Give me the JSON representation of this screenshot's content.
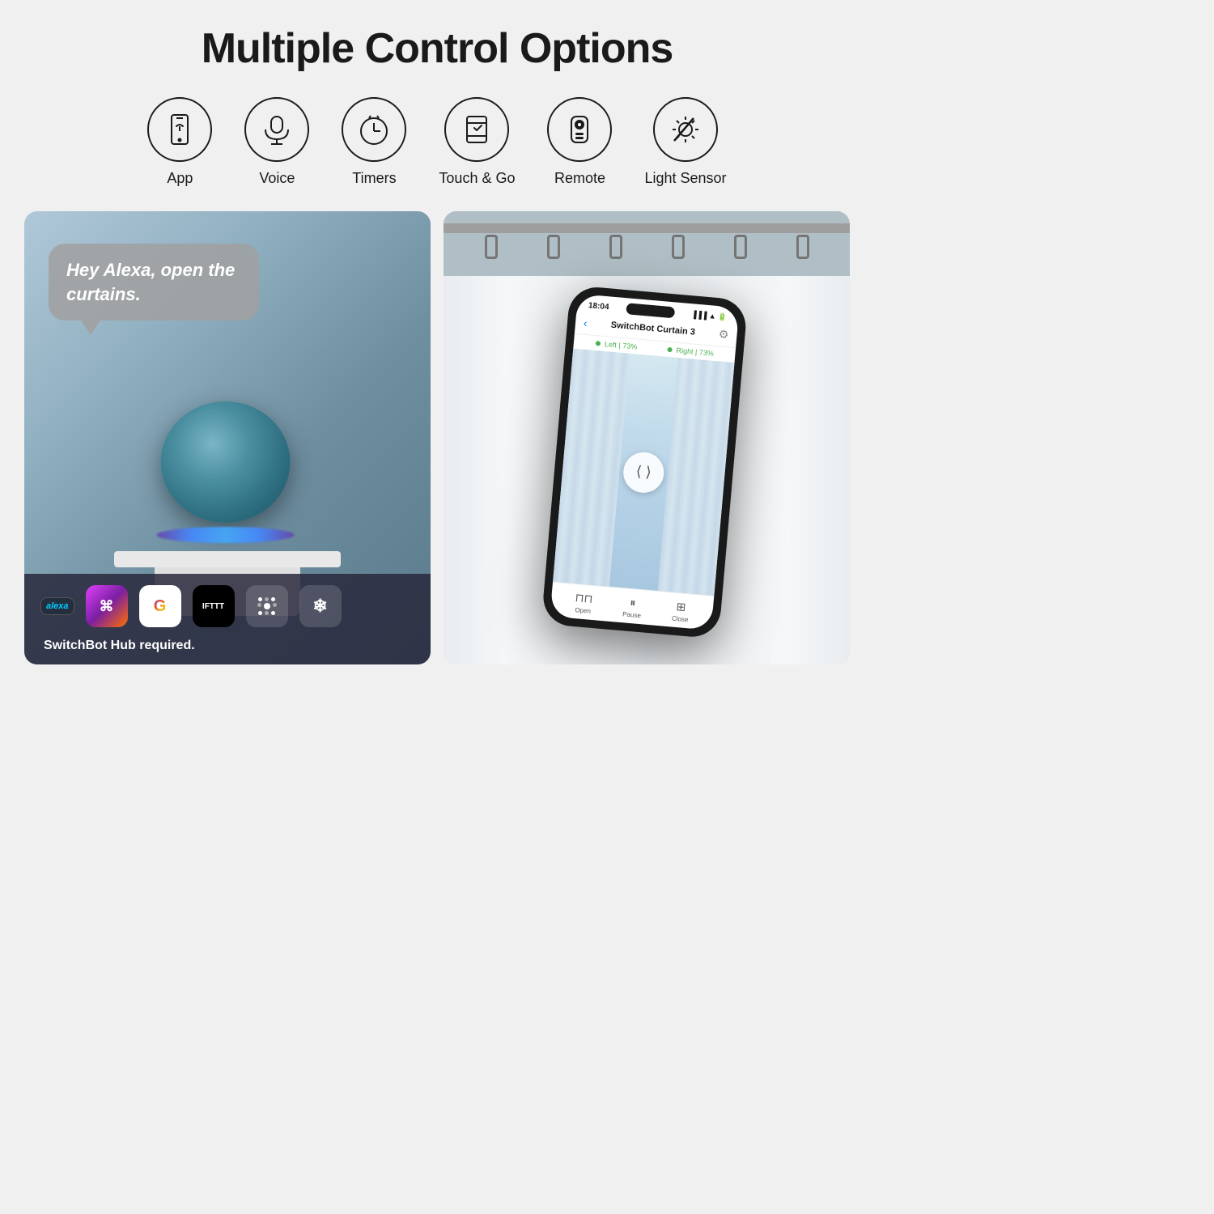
{
  "page": {
    "title": "Multiple Control Options",
    "background_color": "#f0f0f0"
  },
  "control_options": {
    "items": [
      {
        "id": "app",
        "label": "App",
        "icon": "smartphone-icon"
      },
      {
        "id": "voice",
        "label": "Voice",
        "icon": "microphone-icon"
      },
      {
        "id": "timers",
        "label": "Timers",
        "icon": "clock-icon"
      },
      {
        "id": "touch-go",
        "label": "Touch & Go",
        "icon": "touch-icon"
      },
      {
        "id": "remote",
        "label": "Remote",
        "icon": "remote-icon"
      },
      {
        "id": "light-sensor",
        "label": "Light Sensor",
        "icon": "light-sensor-icon"
      }
    ]
  },
  "left_panel": {
    "speech_bubble_text": "Hey Alexa, open the curtains.",
    "hub_required_text": "SwitchBot Hub required.",
    "logos": [
      {
        "id": "alexa",
        "label": "alexa"
      },
      {
        "id": "shortcuts",
        "label": "shortcuts"
      },
      {
        "id": "google",
        "label": "G"
      },
      {
        "id": "ifttt",
        "label": "IFTTT"
      },
      {
        "id": "hub",
        "label": "hub"
      },
      {
        "id": "matter",
        "label": "❄"
      }
    ]
  },
  "right_panel": {
    "phone": {
      "time": "18:04",
      "app_title": "SwitchBot Curtain 3",
      "left_progress": "Left | 73%",
      "right_progress": "Right | 73%",
      "controls": [
        {
          "id": "open",
          "label": "Open"
        },
        {
          "id": "pause",
          "label": "Pause"
        },
        {
          "id": "close",
          "label": "Close"
        }
      ]
    }
  }
}
